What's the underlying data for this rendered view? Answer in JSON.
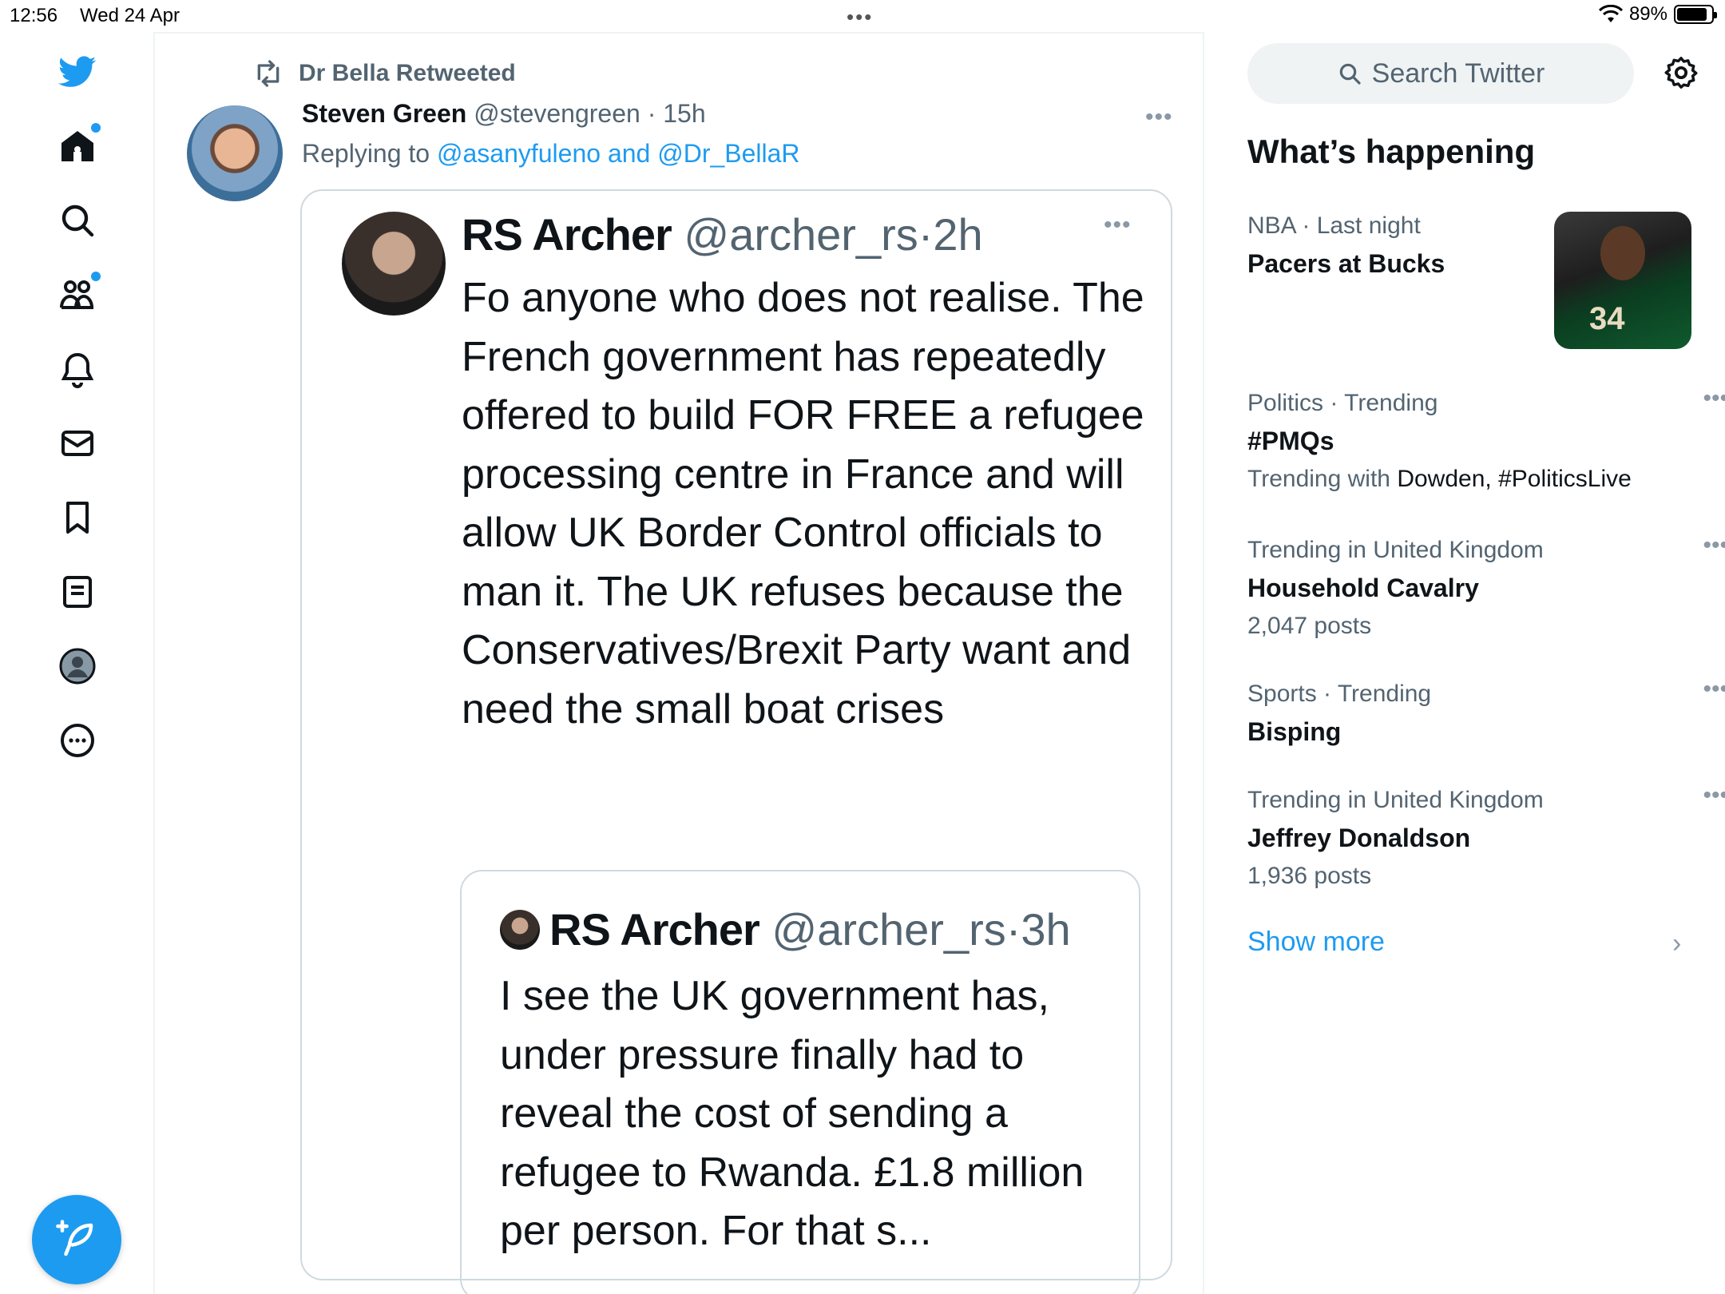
{
  "status_bar": {
    "time": "12:56",
    "date": "Wed 24 Apr",
    "battery": "89%",
    "battery_level": 0.89
  },
  "nav": {
    "items": [
      "twitter-logo",
      "home",
      "explore",
      "communities",
      "notifications",
      "messages",
      "bookmarks",
      "lists",
      "profile",
      "more"
    ]
  },
  "tweet": {
    "retweeted_by": "Dr Bella Retweeted",
    "author_name": "Steven Green",
    "author_handle": "@stevengreen",
    "time": "15h",
    "replying_label": "Replying to",
    "replying_users": "@asanyfuleno and @Dr_BellaR",
    "quote": {
      "author_name": "RS Archer",
      "author_handle": "@archer_rs",
      "time": "2h",
      "text": "Fo anyone who does not realise. The French government has repeatedly offered to build FOR FREE a refugee processing centre in France and will allow UK Border Control officials to man it.  The UK refuses because the Conservatives/Brexit Party want and need  the small boat crises",
      "inner": {
        "author_name": "RS Archer",
        "author_handle": "@archer_rs",
        "time": "3h",
        "text": "I see the UK government has, under pressure finally had to reveal the cost of sending a refugee to Rwanda. £1.8 million per person.  For that s..."
      }
    }
  },
  "sidebar": {
    "search_placeholder": "Search Twitter",
    "section_title": "What’s happening",
    "trends": [
      {
        "category": "NBA · Last night",
        "title": "Pacers at Bucks"
      },
      {
        "category": "Politics · Trending",
        "title": "#PMQs",
        "trending_with_label": "Trending with",
        "trending_with": "Dowden, #PoliticsLive"
      },
      {
        "category": "Trending in United Kingdom",
        "title": "Household Cavalry",
        "posts": "2,047 posts"
      },
      {
        "category": "Sports · Trending",
        "title": "Bisping"
      },
      {
        "category": "Trending in United Kingdom",
        "title": "Jeffrey Donaldson",
        "posts": "1,936 posts"
      }
    ],
    "nba_image_number": "34",
    "show_more": "Show more"
  },
  "colors": {
    "accent": "#1d9bf0",
    "text_primary": "#0f1419",
    "text_secondary": "#536471",
    "border": "#cfd9de"
  }
}
